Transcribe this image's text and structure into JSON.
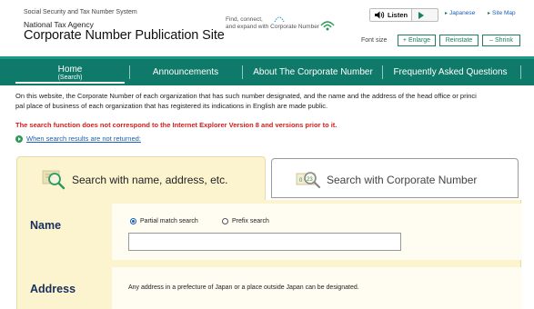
{
  "header": {
    "system_line": "Social Security and Tax Number System",
    "agency": "National Tax Agency",
    "site_title": "Corporate Number Publication Site",
    "tagline_line1": "Find, connect,",
    "tagline_line2": "and expand with Corporate Number",
    "listen_label": "Listen",
    "japanese_link": "Japanese",
    "sitemap_link": "Site Map",
    "font_size_label": "Font size",
    "enlarge_label": "+ Enlarge",
    "reinstate_label": "Reinstate",
    "shrink_label": "– Shrink"
  },
  "nav": {
    "home_label": "Home",
    "home_sub": "(Search)",
    "announcements": "Announcements",
    "about": "About The Corporate Number",
    "faq": "Frequently Asked Questions"
  },
  "content": {
    "intro_line1": "On this website, the Corporate Number of each organization that has such number designated, and the name and the address of the head office or princi",
    "intro_line2": "pal place of business of each organization that has registered its indications in English are made public.",
    "warning": "The search function does not correspond to the Internet Explorer Version 8 and versions prior to it.",
    "help_link": "When search results are not returned:"
  },
  "tabs": {
    "name_search": "Search with name, address, etc.",
    "number_search": "Search with Corporate Number"
  },
  "form": {
    "name_label": "Name",
    "partial_match": "Partial match search",
    "prefix_search": "Prefix search",
    "name_value": "",
    "address_label": "Address",
    "address_note": "Any address in a prefecture of Japan or a place outside Japan can be designated."
  },
  "colors": {
    "nav_green": "#0f7a6a",
    "tab_yellow": "#fbf4cf",
    "warning_red": "#d02020",
    "link_blue": "#1a5fb4"
  }
}
